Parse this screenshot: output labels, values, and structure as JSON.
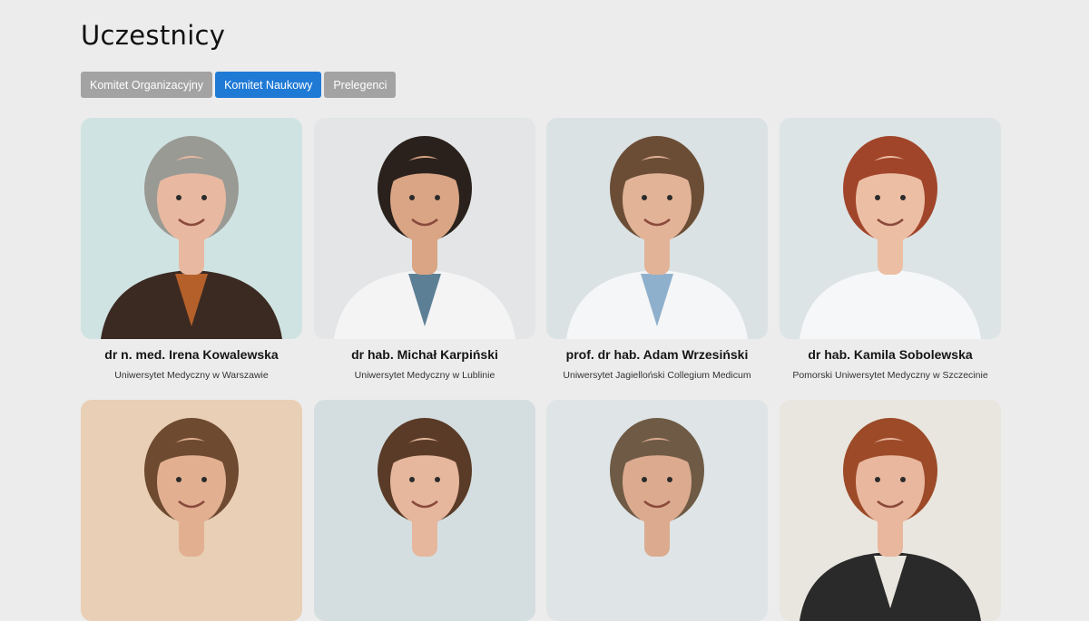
{
  "page": {
    "title": "Uczestnicy"
  },
  "tabs": [
    {
      "label": "Komitet Organizacyjny",
      "active": false
    },
    {
      "label": "Komitet Naukowy",
      "active": true
    },
    {
      "label": "Prelegenci",
      "active": false
    }
  ],
  "people": [
    {
      "name": "dr n. med. Irena Kowalewska",
      "affiliation": "Uniwersytet Medyczny w Warszawie",
      "bg": "#cfe3e2",
      "hair": "#9a9a95",
      "outfit": "#3b2a22",
      "accent": "#b5602a",
      "skin": "#e8b9a0"
    },
    {
      "name": "dr hab. Michał Karpiński",
      "affiliation": "Uniwersytet Medyczny w Lublinie",
      "bg": "#e3e5e7",
      "hair": "#2a211c",
      "outfit": "#f4f4f4",
      "accent": "#5d7f96",
      "skin": "#d9a584"
    },
    {
      "name": "prof. dr hab. Adam Wrzesiński",
      "affiliation": "Uniwersytet Jagielloński Collegium Medicum",
      "bg": "#dbe2e4",
      "hair": "#6b4d36",
      "outfit": "#f5f6f7",
      "accent": "#8fb0cc",
      "skin": "#e2b397"
    },
    {
      "name": "dr hab. Kamila Sobolewska",
      "affiliation": "Pomorski Uniwersytet Medyczny w Szczecinie",
      "bg": "#dde4e6",
      "hair": "#a1452a",
      "outfit": "#f6f7f8",
      "accent": "#f6f7f8",
      "skin": "#ecbfa5"
    },
    {
      "name": "",
      "affiliation": "",
      "bg": "#e9cfb5",
      "hair": "#6d4a30",
      "outfit": "#e9cfb5",
      "accent": "#e9cfb5",
      "skin": "#e2b091"
    },
    {
      "name": "",
      "affiliation": "",
      "bg": "#d4dee0",
      "hair": "#5a3b27",
      "outfit": "#d4dee0",
      "accent": "#d4dee0",
      "skin": "#e6b79d"
    },
    {
      "name": "",
      "affiliation": "",
      "bg": "#dfe5e7",
      "hair": "#6e5a45",
      "outfit": "#dfe5e7",
      "accent": "#dfe5e7",
      "skin": "#dcab8f"
    },
    {
      "name": "",
      "affiliation": "",
      "bg": "#e9e6df",
      "hair": "#9c4a28",
      "outfit": "#2a2a2a",
      "accent": "#e9e6df",
      "skin": "#e9b79e"
    }
  ]
}
